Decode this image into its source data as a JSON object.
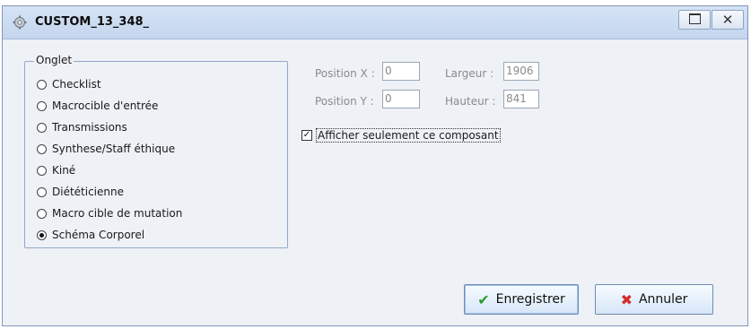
{
  "window": {
    "title": "CUSTOM_13_348_"
  },
  "group": {
    "legend": "Onglet",
    "options": [
      {
        "label": "Checklist",
        "checked": false
      },
      {
        "label": "Macrocible d'entrée",
        "checked": false
      },
      {
        "label": "Transmissions",
        "checked": false
      },
      {
        "label": "Synthese/Staff éthique",
        "checked": false
      },
      {
        "label": "Kiné",
        "checked": false
      },
      {
        "label": "Diététicienne",
        "checked": false
      },
      {
        "label": "Macro cible de mutation",
        "checked": false
      },
      {
        "label": "Schéma Corporel",
        "checked": true
      }
    ]
  },
  "position": {
    "x_label": "Position X :",
    "x_value": "0",
    "y_label": "Position Y :",
    "y_value": "0"
  },
  "size": {
    "width_label": "Largeur :",
    "width_value": "1906",
    "height_label": "Hauteur :",
    "height_value": "841"
  },
  "option": {
    "label": "Afficher seulement ce composant",
    "checked": true
  },
  "buttons": {
    "save": "Enregistrer",
    "cancel": "Annuler"
  }
}
